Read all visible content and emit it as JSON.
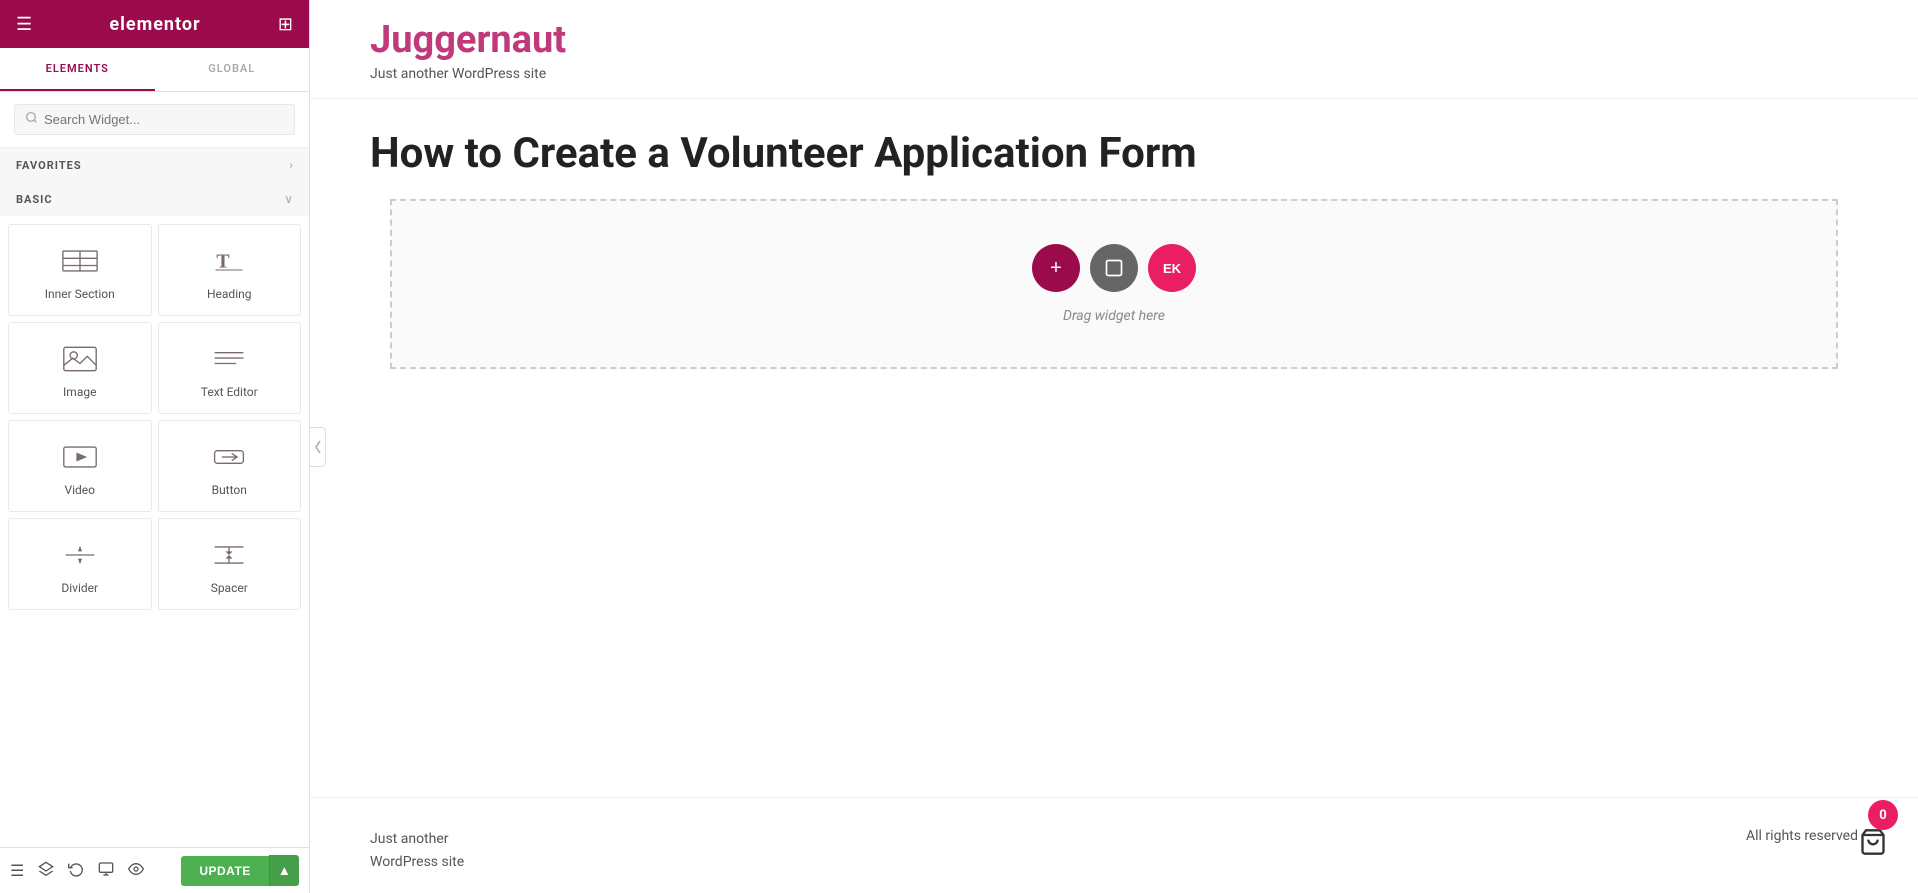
{
  "header": {
    "logo": "elementor",
    "hamburger_icon": "☰",
    "grid_icon": "⊞"
  },
  "tabs": [
    {
      "label": "ELEMENTS",
      "active": true
    },
    {
      "label": "GLOBAL",
      "active": false
    }
  ],
  "search": {
    "placeholder": "Search Widget..."
  },
  "sections": {
    "favorites": {
      "label": "FAVORITES",
      "chevron": "›"
    },
    "basic": {
      "label": "BASIC",
      "chevron": "∨"
    }
  },
  "widgets": [
    {
      "id": "inner-section",
      "label": "Inner Section"
    },
    {
      "id": "heading",
      "label": "Heading"
    },
    {
      "id": "image",
      "label": "Image"
    },
    {
      "id": "text-editor",
      "label": "Text Editor"
    },
    {
      "id": "video",
      "label": "Video"
    },
    {
      "id": "button",
      "label": "Button"
    },
    {
      "id": "divider",
      "label": "Divider"
    },
    {
      "id": "spacer",
      "label": "Spacer"
    }
  ],
  "toolbar": {
    "update_label": "UPDATE",
    "icons": [
      "layers",
      "history",
      "undo",
      "preview",
      "eye"
    ]
  },
  "preview": {
    "site_title": "Juggernaut",
    "site_tagline": "Just another WordPress site",
    "post_title": "How to Create a Volunteer Application Form",
    "drop_zone_text": "Drag widget here",
    "footer_left_line1": "Just another",
    "footer_left_line2": "WordPress site",
    "footer_right": "All rights reserved",
    "notification_count": "0"
  },
  "colors": {
    "brand": "#9b0a4a",
    "pink": "#c0397a",
    "green": "#4caf50",
    "gray_text": "#555",
    "light_bg": "#f7f7f7"
  }
}
